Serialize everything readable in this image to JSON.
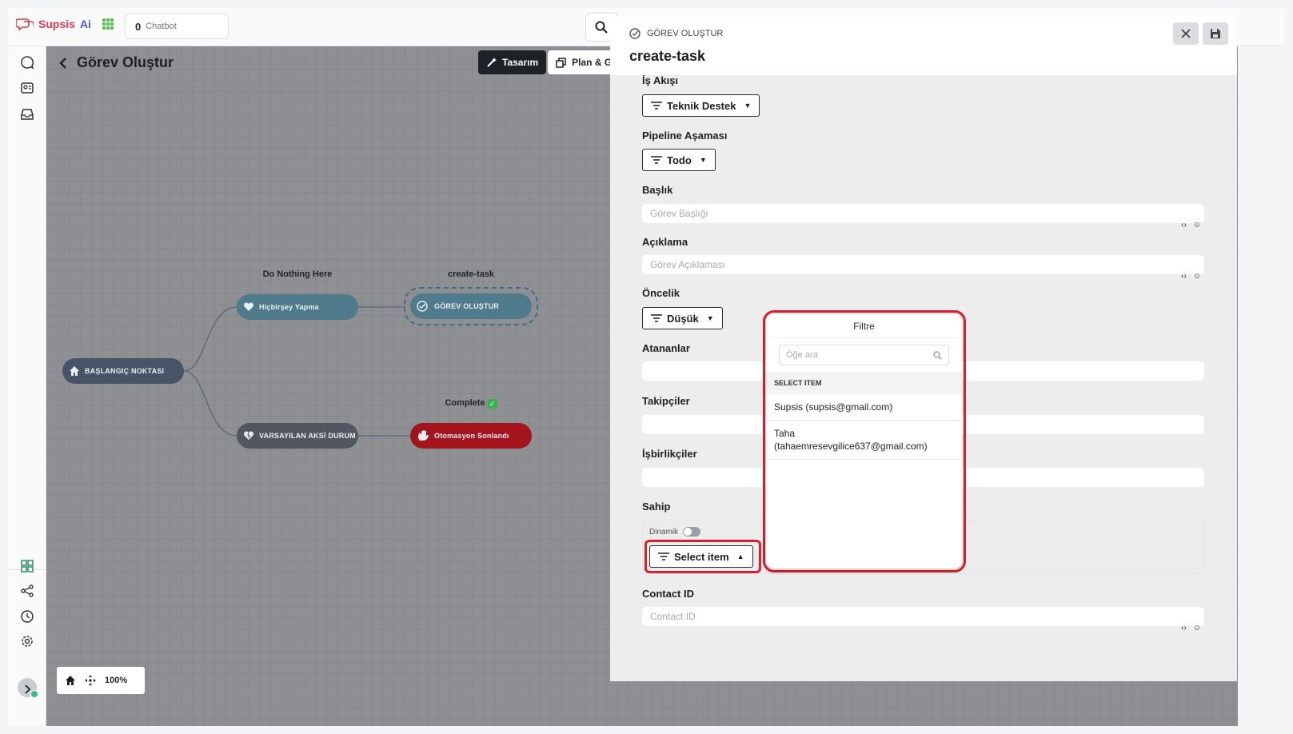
{
  "app": {
    "brand_name": "Supsis",
    "brand_suffix": "Ai"
  },
  "topbar": {
    "chatbot_count": "0",
    "chatbot_label": "Chatbot"
  },
  "canvas": {
    "title": "Görev Oluştur",
    "modes": [
      {
        "label": "Tasarım"
      },
      {
        "label": "Plan & G"
      }
    ],
    "zoom": "100%",
    "nodes": {
      "start": "BAŞLANGIÇ NOKTASI",
      "nothing": "Hiçbirşey Yapma",
      "nothing_label": "Do Nothing Here",
      "create": "GÖREV OLUŞTUR",
      "create_label": "create-task",
      "default": "VARSAYILAN AKSİ DURUM",
      "end": "Otomasyon Sonlandı",
      "end_label": "Complete"
    }
  },
  "panel": {
    "subtitle": "GÖREV OLUŞTUR",
    "title": "create-task",
    "fields": {
      "workflow": {
        "label": "İş Akışı",
        "value": "Teknik Destek"
      },
      "pipeline": {
        "label": "Pipeline Aşaması",
        "value": "Todo"
      },
      "title": {
        "label": "Başlık",
        "placeholder": "Görev Başlığı"
      },
      "description": {
        "label": "Açıklama",
        "placeholder": "Görev Açıklaması"
      },
      "priority": {
        "label": "Öncelik",
        "value": "Düşük"
      },
      "assignees": {
        "label": "Atananlar"
      },
      "followers": {
        "label": "Takipçiler"
      },
      "collaborators": {
        "label": "İşbirlikçiler"
      },
      "owner": {
        "label": "Sahip",
        "dynamic_label": "Dinamik",
        "value": "Select item"
      },
      "contact": {
        "label": "Contact ID",
        "placeholder": "Contact ID"
      }
    },
    "tools": {
      "code": "‹›",
      "emoji": "☺"
    }
  },
  "dropdown": {
    "title": "Filtre",
    "search_placeholder": "Öğe ara",
    "section": "SELECT ITEM",
    "items": [
      {
        "line1": "Supsis (supsis@gmail.com)"
      },
      {
        "line1": "Taha",
        "line2": "(tahaemresevgilice637@gmail.com)"
      }
    ]
  },
  "colors": {
    "accent_red": "#d8212f",
    "node_teal": "#4f7b8d",
    "node_red": "#a3141d",
    "brand_red": "#e23b4e"
  }
}
